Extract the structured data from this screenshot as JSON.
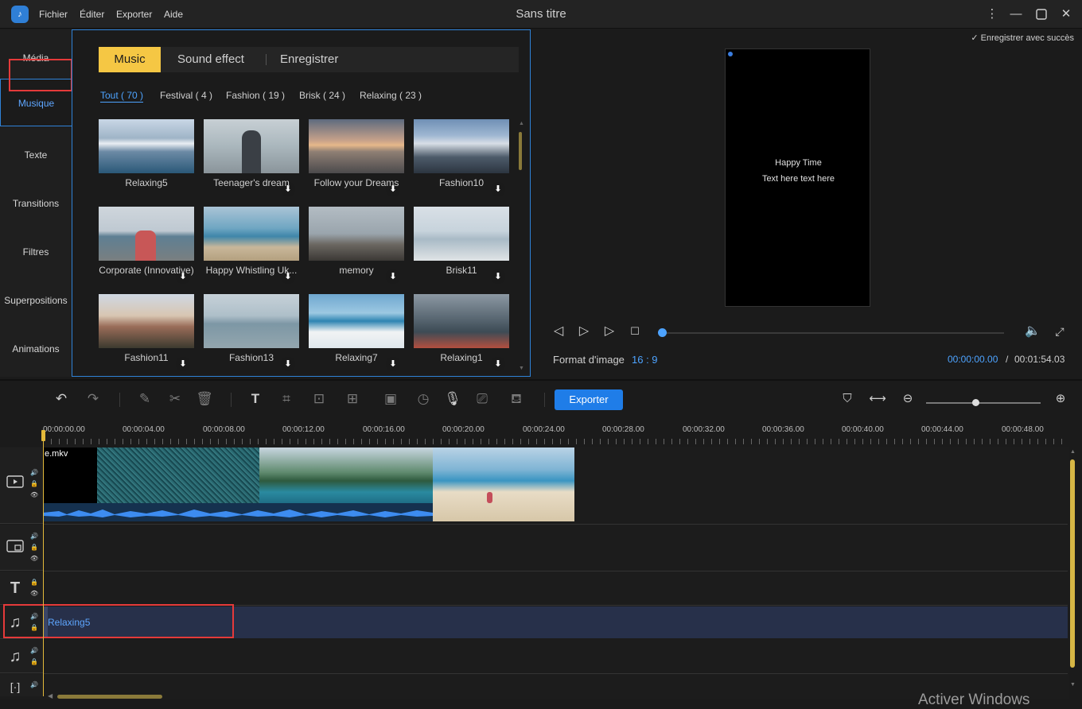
{
  "titlebar": {
    "logo": "app-logo",
    "menus": [
      "Fichier",
      "Éditer",
      "Exporter",
      "Aide"
    ],
    "title": "Sans titre",
    "controls": [
      "more-vertical-icon",
      "minimize-icon",
      "maximize-icon",
      "close-icon"
    ]
  },
  "left_tabs": [
    "Média",
    "Musique",
    "Texte",
    "Transitions",
    "Filtres",
    "Superpositions",
    "Animations"
  ],
  "library": {
    "tabs": [
      "Music",
      "Sound effect",
      "Enregistrer"
    ],
    "categories": [
      "Tout ( 70 )",
      "Festival ( 4 )",
      "Fashion ( 19 )",
      "Brisk ( 24 )",
      "Relaxing ( 23 )"
    ],
    "items": [
      "Relaxing5",
      "Teenager's dream",
      "Follow your Dreams",
      "Fashion10",
      "Corporate (Innovative)",
      "Happy Whistling Uk...",
      "memory",
      "Brisk11",
      "Fashion11",
      "Fashion13",
      "Relaxing7",
      "Relaxing1"
    ]
  },
  "preview": {
    "save_status": "Enregistrer avec succès",
    "phone_title": "Happy Time",
    "phone_subtitle": "Text here text here",
    "format_label": "Format d'image",
    "format_value": "16 : 9",
    "time_current": "00:00:00.00",
    "time_sep": "/",
    "time_total": "00:01:54.03"
  },
  "toolbar": {
    "export_label": "Exporter"
  },
  "timeline": {
    "ruler": [
      "00:00:00.00",
      "00:00:04.00",
      "00:00:08.00",
      "00:00:12.00",
      "00:00:16.00",
      "00:00:20.00",
      "00:00:24.00",
      "00:00:28.00",
      "00:00:32.00",
      "00:00:36.00",
      "00:00:40.00",
      "00:00:44.00",
      "00:00:48.00"
    ],
    "video_clip_label": "e.mkv",
    "music_clip_label": "Relaxing5"
  },
  "watermark": "Activer Windows",
  "colors": {
    "accent": "#2f82d8",
    "music_tab": "#f5c744",
    "highlight": "#e53a3a",
    "export": "#1f7de8"
  }
}
